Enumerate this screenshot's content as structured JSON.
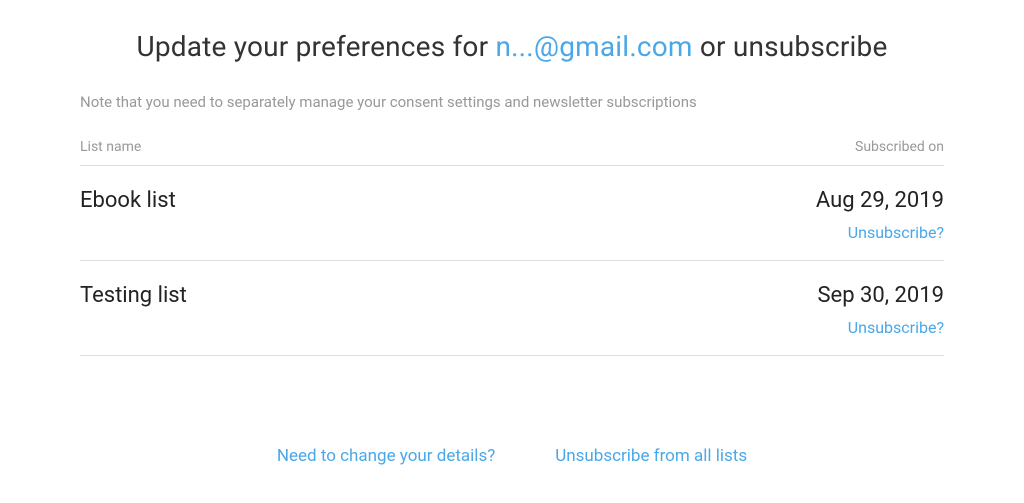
{
  "header": {
    "title_prefix": "Update your preferences for ",
    "email": "n...@gmail.com",
    "title_suffix": " or unsubscribe"
  },
  "note": "Note that you need to separately manage your consent settings and newsletter subscriptions",
  "table": {
    "col_name": "List name",
    "col_date": "Subscribed on"
  },
  "subscriptions": [
    {
      "name": "Ebook list",
      "date": "Aug 29, 2019",
      "unsubscribe_label": "Unsubscribe?"
    },
    {
      "name": "Testing list",
      "date": "Sep 30, 2019",
      "unsubscribe_label": "Unsubscribe?"
    }
  ],
  "footer": {
    "change_details": "Need to change your details?",
    "unsubscribe_all": "Unsubscribe from all lists"
  }
}
